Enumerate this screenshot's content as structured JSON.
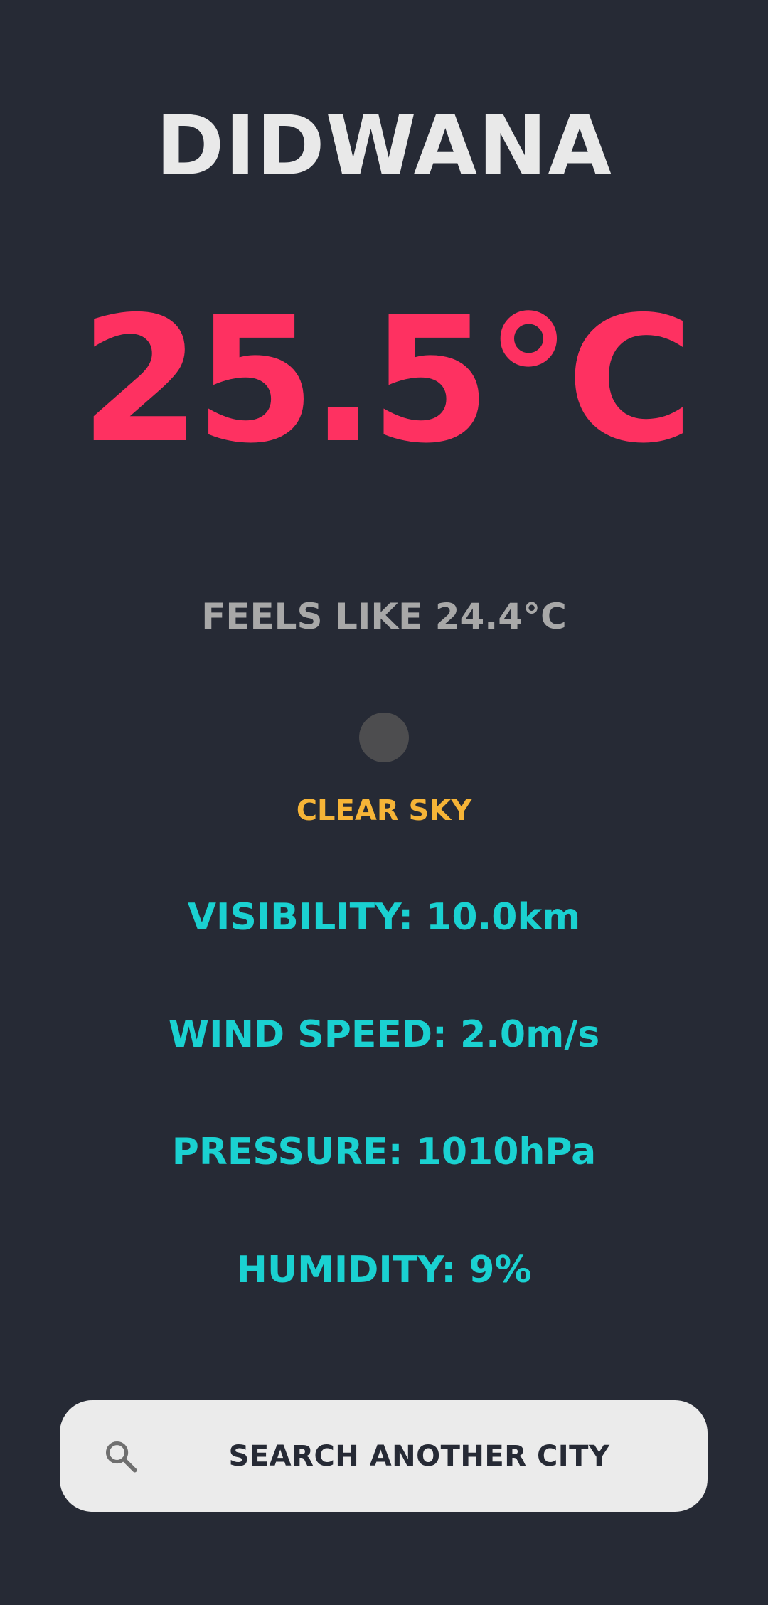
{
  "city": "DIDWANA",
  "temperature": "25.5°C",
  "feels_like": "FEELS LIKE 24.4°C",
  "weather": {
    "icon": "weather-icon",
    "description": "CLEAR SKY"
  },
  "stats": {
    "visibility": "VISIBILITY: 10.0km",
    "wind_speed": "WIND SPEED: 2.0m/s",
    "pressure": "PRESSURE: 1010hPa",
    "humidity": "HUMIDITY: 9%"
  },
  "search": {
    "label": "SEARCH ANOTHER CITY",
    "icon": "search-icon"
  },
  "colors": {
    "background": "#262a35",
    "city": "#e9e9e9",
    "temperature": "#fe3161",
    "feels_like": "#a8a8a8",
    "description": "#f6b437",
    "stats": "#1ad1d1",
    "search_bg": "#ebebeb"
  }
}
